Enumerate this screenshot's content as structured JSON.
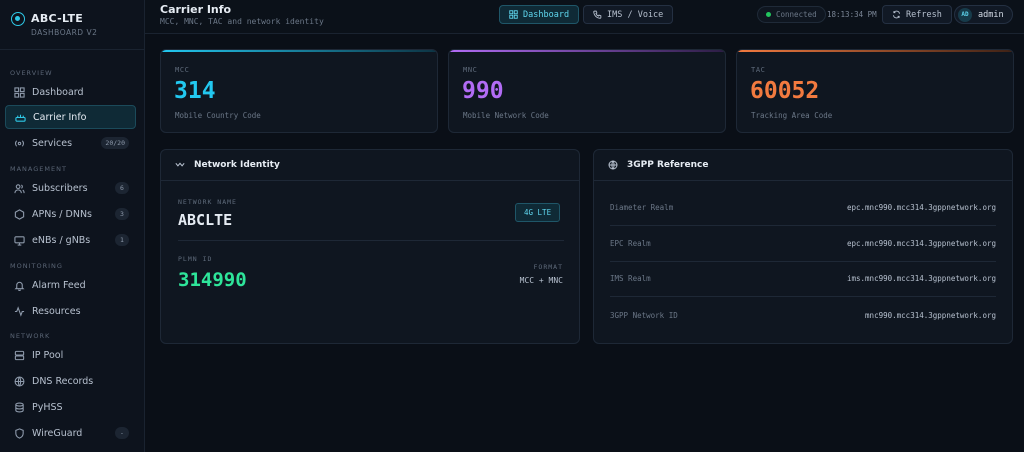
{
  "brand": {
    "title": "ABC-LTE",
    "subtitle": "DASHBOARD V2"
  },
  "sidebar": {
    "sections": [
      {
        "label": "OVERVIEW",
        "items": [
          {
            "label": "Dashboard",
            "icon": "grid-icon"
          },
          {
            "label": "Carrier Info",
            "icon": "carrier-icon",
            "active": true
          },
          {
            "label": "Services",
            "icon": "radio-icon",
            "badge": "20/20"
          }
        ]
      },
      {
        "label": "MANAGEMENT",
        "items": [
          {
            "label": "Subscribers",
            "icon": "users-icon",
            "badge": "6"
          },
          {
            "label": "APNs / DNNs",
            "icon": "hexagon-icon",
            "badge": "3"
          },
          {
            "label": "eNBs / gNBs",
            "icon": "monitor-icon",
            "badge": "1"
          }
        ]
      },
      {
        "label": "MONITORING",
        "items": [
          {
            "label": "Alarm Feed",
            "icon": "bell-icon"
          },
          {
            "label": "Resources",
            "icon": "activity-icon"
          }
        ]
      },
      {
        "label": "NETWORK",
        "items": [
          {
            "label": "IP Pool",
            "icon": "server-icon"
          },
          {
            "label": "DNS Records",
            "icon": "globe-icon"
          },
          {
            "label": "PyHSS",
            "icon": "database-icon"
          },
          {
            "label": "WireGuard",
            "icon": "shield-icon",
            "badge": "-"
          }
        ]
      }
    ]
  },
  "header": {
    "title": "Carrier Info",
    "subtitle": "MCC, MNC, TAC and network identity",
    "tabs": [
      {
        "label": "Dashboard",
        "icon": "grid-icon",
        "active": true
      },
      {
        "label": "IMS / Voice",
        "icon": "phone-icon"
      }
    ],
    "status": "Connected",
    "time": "18:13:34 PM",
    "refresh_label": "Refresh",
    "user": {
      "initials": "AD",
      "name": "admin"
    }
  },
  "stats": [
    {
      "label": "MCC",
      "value": "314",
      "desc": "Mobile Country Code",
      "color": "#22c8f0"
    },
    {
      "label": "MNC",
      "value": "990",
      "desc": "Mobile Network Code",
      "color": "#b26cf5"
    },
    {
      "label": "TAC",
      "value": "60052",
      "desc": "Tracking Area Code",
      "color": "#f27a3f"
    }
  ],
  "network_identity": {
    "title": "Network Identity",
    "name_label": "NETWORK NAME",
    "name": "ABCLTE",
    "tag": "4G LTE",
    "plmn_label": "PLMN ID",
    "plmn": "314990",
    "format_label": "FORMAT",
    "format": "MCC + MNC"
  },
  "reference": {
    "title": "3GPP Reference",
    "rows": [
      {
        "key": "Diameter Realm",
        "value": "epc.mnc990.mcc314.3gppnetwork.org"
      },
      {
        "key": "EPC Realm",
        "value": "epc.mnc990.mcc314.3gppnetwork.org"
      },
      {
        "key": "IMS Realm",
        "value": "ims.mnc990.mcc314.3gppnetwork.org"
      },
      {
        "key": "3GPP Network ID",
        "value": "mnc990.mcc314.3gppnetwork.org"
      }
    ]
  }
}
